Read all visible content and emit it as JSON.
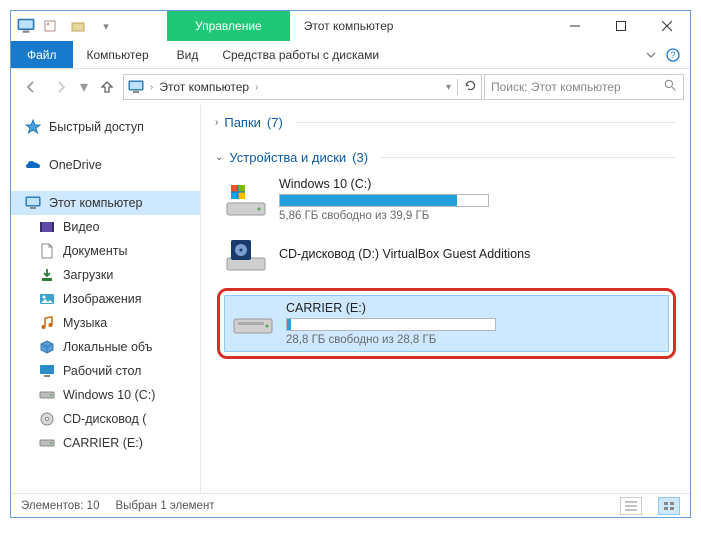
{
  "titlebar": {
    "context_tab": "Управление",
    "title": "Этот компьютер"
  },
  "tabs": {
    "file": "Файл",
    "items": [
      "Компьютер",
      "Вид"
    ],
    "context_sub": "Средства работы с дисками"
  },
  "address": {
    "crumb": "Этот компьютер",
    "search_placeholder": "Поиск: Этот компьютер"
  },
  "nav_pane": {
    "quick_access": "Быстрый доступ",
    "onedrive": "OneDrive",
    "this_pc": "Этот компьютер",
    "items": [
      {
        "label": "Видео"
      },
      {
        "label": "Документы"
      },
      {
        "label": "Загрузки"
      },
      {
        "label": "Изображения"
      },
      {
        "label": "Музыка"
      },
      {
        "label": "Локальные объ"
      },
      {
        "label": "Рабочий стол"
      },
      {
        "label": "Windows 10 (C:)"
      },
      {
        "label": "CD-дисковод ("
      },
      {
        "label": "CARRIER (E:)"
      }
    ]
  },
  "groups": {
    "folders": {
      "label": "Папки",
      "count": "(7)"
    },
    "devices": {
      "label": "Устройства и диски",
      "count": "(3)"
    }
  },
  "drives": [
    {
      "name": "Windows 10 (C:)",
      "sub": "5,86 ГБ свободно из 39,9 ГБ",
      "fill_pct": 85
    },
    {
      "name": "CD-дисковод (D:) VirtualBox Guest Additions",
      "sub": "",
      "fill_pct": 0
    },
    {
      "name": "CARRIER (E:)",
      "sub": "28,8 ГБ свободно из 28,8 ГБ",
      "fill_pct": 2
    }
  ],
  "statusbar": {
    "count": "Элементов: 10",
    "selection": "Выбран 1 элемент"
  }
}
